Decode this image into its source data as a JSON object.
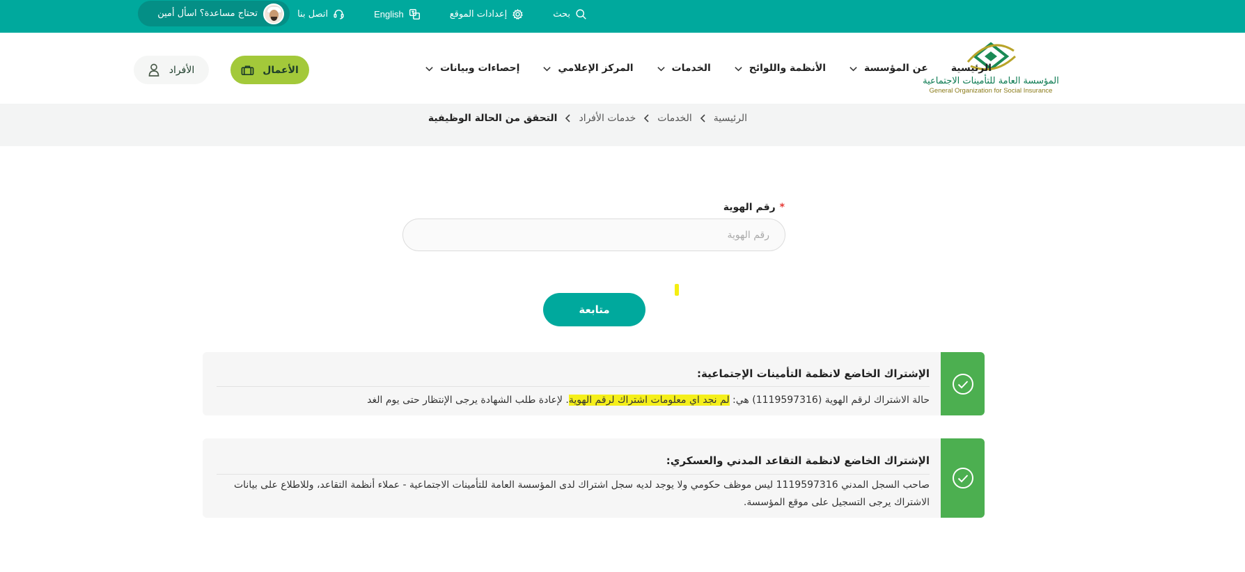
{
  "topbar": {
    "search": "بحث",
    "settings": "إعدادات الموقع",
    "language": "English",
    "contact": "اتصل بنا",
    "help": "تحتاج مساعدة؟ اسأل أمين",
    "color": "#00a99d"
  },
  "header": {
    "logo_ar": "المؤسسة العامة للتأمينات الاجتماعية",
    "logo_en": "General Organization for Social Insurance",
    "nav": [
      {
        "label": "الرئيسية"
      },
      {
        "label": "عن المؤسسة"
      },
      {
        "label": "الأنظمة واللوائح"
      },
      {
        "label": "الخدمات"
      },
      {
        "label": "المركز الإعلامي"
      },
      {
        "label": "إحصاءات وبيانات"
      }
    ],
    "business_button": "الأعمال",
    "individuals_button": "الأفراد"
  },
  "breadcrumb": [
    "الرئيسية",
    "الخدمات",
    "خدمات الأفراد",
    "التحقق من الحالة الوظيفية"
  ],
  "form": {
    "label": "رقم الهوية",
    "required_mark": "*",
    "placeholder": "رقم الهوية",
    "value": "",
    "submit": "متابعة"
  },
  "results": [
    {
      "title": "الإشتراك الخاضع لانظمة التأمينات الإجتماعية:",
      "text_before": "حالة الاشتراك لرقم الهوية (1119597316) هي: ",
      "text_highlight": "لم نجد اي معلومات اشتراك لرقم الهوية",
      "text_after": ". لإعادة طلب الشهادة يرجى الإنتظار حتى يوم الغد"
    },
    {
      "title": "الإشتراك الخاضع لانظمة التقاعد المدني والعسكري:",
      "text": "صاحب السجل المدني 1119597316 ليس موظف حكومي ولا يوجد لديه سجل اشتراك لدى المؤسسة العامة للتأمينات الاجتماعية - عملاء أنظمة التقاعد، وللاطلاع على بيانات الاشتراك يرجى التسجيل على موقع المؤسسة."
    }
  ],
  "colors": {
    "primary": "#00a99d",
    "accent": "#a3c93a",
    "success": "#4caf50",
    "highlight": "#f5ef1a"
  }
}
